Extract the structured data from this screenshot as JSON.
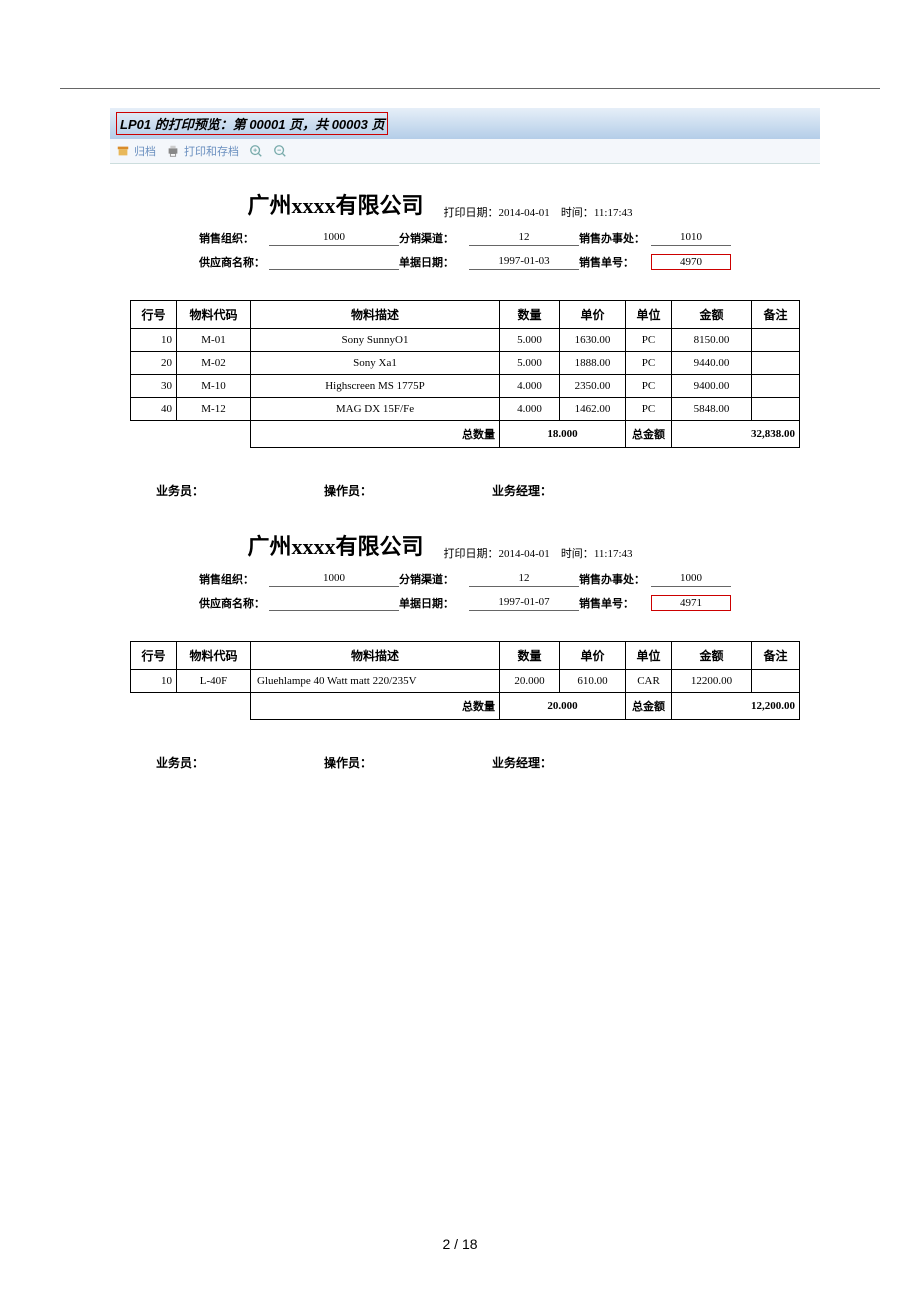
{
  "title": {
    "prefix": "LP01",
    "mid1": " 的打印预览：第 ",
    "page": "00001",
    "mid2": " 页，共 ",
    "total": "00003",
    "suffix": "  页"
  },
  "toolbar": {
    "archive": "归档",
    "print_save": "打印和存档"
  },
  "company": "广州xxxx有限公司",
  "print_meta": {
    "date_label": "打印日期：",
    "date": "2014-04-01",
    "time_label": "时间：",
    "time": "11:17:43"
  },
  "labels": {
    "sales_org": "销售组织：",
    "channel": "分销渠道：",
    "office": "销售办事处：",
    "supplier": "供应商名称：",
    "doc_date": "单据日期：",
    "sales_no": "销售单号："
  },
  "th": {
    "row": "行号",
    "code": "物料代码",
    "desc": "物料描述",
    "qty": "数量",
    "price": "单价",
    "unit": "单位",
    "amount": "金额",
    "remark": "备注",
    "tqty": "总数量",
    "tamt": "总金额"
  },
  "sig": {
    "sales": "业务员：",
    "op": "操作员：",
    "mgr": "业务经理："
  },
  "orders": [
    {
      "sales_org": "1000",
      "channel": "12",
      "office": "1010",
      "supplier": "",
      "doc_date": "1997-01-03",
      "sales_no": "4970",
      "rows": [
        {
          "no": "10",
          "code": "M-01",
          "desc": "Sony SunnyO1",
          "qty": "5.000",
          "price": "1630.00",
          "unit": "PC",
          "amount": "8150.00"
        },
        {
          "no": "20",
          "code": "M-02",
          "desc": "Sony Xa1",
          "qty": "5.000",
          "price": "1888.00",
          "unit": "PC",
          "amount": "9440.00"
        },
        {
          "no": "30",
          "code": "M-10",
          "desc": "Highscreen MS 1775P",
          "qty": "4.000",
          "price": "2350.00",
          "unit": "PC",
          "amount": "9400.00"
        },
        {
          "no": "40",
          "code": "M-12",
          "desc": "MAG DX 15F/Fe",
          "qty": "4.000",
          "price": "1462.00",
          "unit": "PC",
          "amount": "5848.00"
        }
      ],
      "tqty": "18.000",
      "tamt": "32,838.00"
    },
    {
      "sales_org": "1000",
      "channel": "12",
      "office": "1000",
      "supplier": "",
      "doc_date": "1997-01-07",
      "sales_no": "4971",
      "rows": [
        {
          "no": "10",
          "code": "L-40F",
          "desc": "Gluehlampe 40 Watt matt 220/235V",
          "qty": "20.000",
          "price": "610.00",
          "unit": "CAR",
          "amount": "12200.00"
        }
      ],
      "tqty": "20.000",
      "tamt": "12,200.00"
    }
  ],
  "pager": {
    "cur": "2",
    "sep": " / ",
    "tot": "18"
  }
}
